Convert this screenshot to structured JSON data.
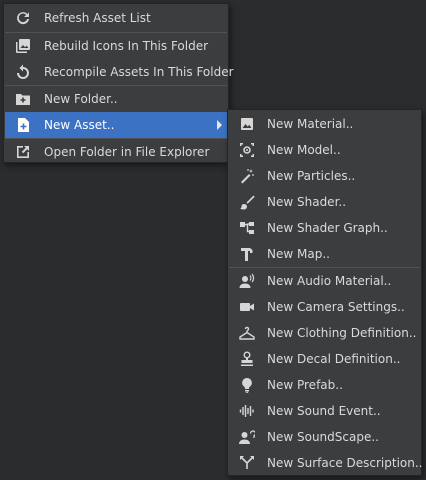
{
  "main_menu": {
    "items": [
      {
        "label": "Refresh Asset List",
        "icon": "refresh-icon"
      },
      {
        "label": "Rebuild Icons In This Folder",
        "icon": "image-stack-icon"
      },
      {
        "label": "Recompile Assets In This Folder",
        "icon": "recompile-icon"
      },
      {
        "label": "New Folder..",
        "icon": "new-folder-icon"
      },
      {
        "label": "New Asset..",
        "icon": "new-file-icon",
        "highlighted": true
      },
      {
        "label": "Open Folder in File Explorer",
        "icon": "open-external-icon"
      }
    ]
  },
  "sub_menu": {
    "items": [
      {
        "label": "New Material..",
        "icon": "image-icon"
      },
      {
        "label": "New Model..",
        "icon": "model-icon"
      },
      {
        "label": "New Particles..",
        "icon": "magic-wand-icon"
      },
      {
        "label": "New Shader..",
        "icon": "brush-icon"
      },
      {
        "label": "New Shader Graph..",
        "icon": "graph-icon"
      },
      {
        "label": "New Map..",
        "icon": "hammer-icon"
      },
      {
        "label": "New Audio Material..",
        "icon": "audio-person-icon"
      },
      {
        "label": "New Camera Settings..",
        "icon": "video-camera-icon"
      },
      {
        "label": "New Clothing Definition..",
        "icon": "hanger-icon"
      },
      {
        "label": "New Decal Definition..",
        "icon": "stamp-icon"
      },
      {
        "label": "New Prefab..",
        "icon": "lightbulb-icon"
      },
      {
        "label": "New Sound Event..",
        "icon": "waveform-icon"
      },
      {
        "label": "New SoundScape..",
        "icon": "person-sound-icon"
      },
      {
        "label": "New Surface Description..",
        "icon": "merge-icon"
      }
    ]
  },
  "colors": {
    "menu_bg": "#3b3d3f",
    "highlight": "#3c72c4",
    "text": "#d9dadb",
    "background": "#2b2c2e"
  }
}
